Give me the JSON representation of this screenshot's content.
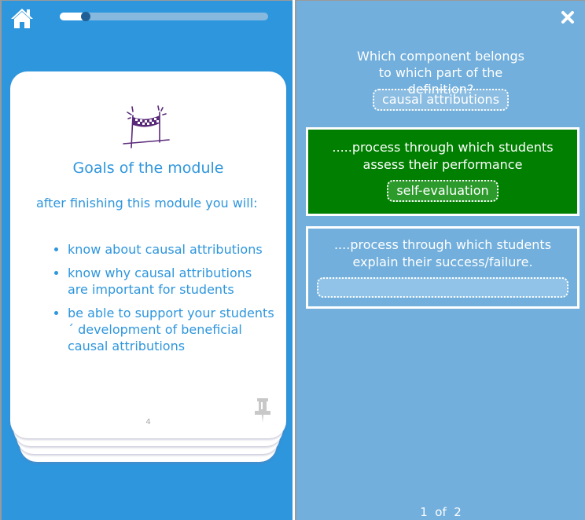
{
  "left": {
    "home_icon": "home-icon",
    "progress": {
      "fraction": 0.125
    },
    "card": {
      "icon": "finish-line-icon",
      "title": "Goals of the module",
      "intro": "after finishing this module you will:",
      "goals": [
        "know about causal attributions",
        "know why causal attributions are important for students",
        "be able to support your students´ development of beneficial causal attributions"
      ],
      "page_number": "4",
      "pin_icon": "pushpin-icon"
    }
  },
  "right": {
    "close_icon": "close-icon",
    "question": "Which component belongs to which part of the definition?",
    "draggable_option": "causal attributions",
    "targets": [
      {
        "text": ".....process through which students assess their performance",
        "answer": "self-evaluation",
        "state": "correct"
      },
      {
        "text": "....process through which students explain their success/failure.",
        "answer": "",
        "state": "empty"
      }
    ],
    "pager": "1  of  2"
  },
  "colors": {
    "left_bg": "#2e96dd",
    "right_bg": "#72afdc",
    "correct_green": "#007f00",
    "card_text": "#2e96dd",
    "icon_purple": "#5a2a7a"
  }
}
